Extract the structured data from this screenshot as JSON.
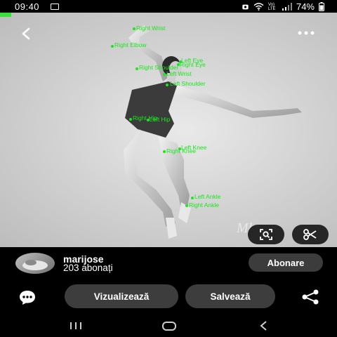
{
  "status_bar": {
    "time": "09:40",
    "network": "Vo) LTE",
    "battery": "74%",
    "icons": [
      "gallery-icon",
      "alarm-icon",
      "wifi-icon",
      "signal-icon",
      "battery-icon"
    ]
  },
  "photo": {
    "watermark": "Ml",
    "pose_labels": [
      {
        "key": "right-wrist",
        "text": "Right Wrist"
      },
      {
        "key": "right-elbow",
        "text": "Right Elbow"
      },
      {
        "key": "left-eye",
        "text": "Left Eye"
      },
      {
        "key": "right-eye",
        "text": "Right Eye"
      },
      {
        "key": "right-shoulder",
        "text": "Right Shoulder"
      },
      {
        "key": "left-wrist",
        "text": "Left Wrist"
      },
      {
        "key": "left-shoulder",
        "text": "Left Shoulder"
      },
      {
        "key": "right-hip",
        "text": "Right Hip"
      },
      {
        "key": "left-hip",
        "text": "Left Hip"
      },
      {
        "key": "left-knee",
        "text": "Left Knee"
      },
      {
        "key": "right-knee",
        "text": "Right Knee"
      },
      {
        "key": "left-ankle",
        "text": "Left Ankle"
      },
      {
        "key": "right-ankle",
        "text": "Right Ankle"
      }
    ]
  },
  "profile": {
    "username": "marijose",
    "followers": "203 abonați",
    "follow_label": "Abonare"
  },
  "actions": {
    "view_label": "Vizualizează",
    "save_label": "Salvează"
  },
  "colors": {
    "pose_green": "#17e81b",
    "pill_bg": "#3d3d3d",
    "background": "#000000"
  }
}
